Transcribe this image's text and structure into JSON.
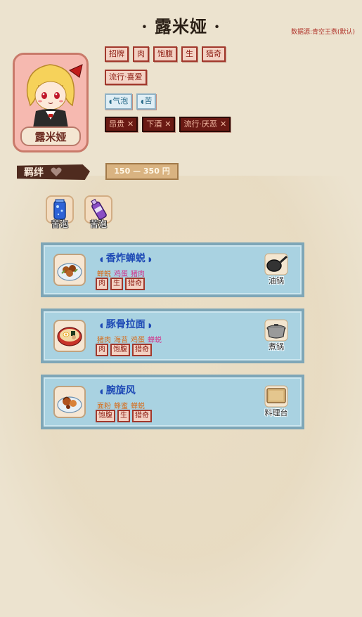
{
  "header": {
    "title": "· 露米娅 ·",
    "data_source": "数据源:青空王燕(默认)"
  },
  "character": {
    "name": "露米娅",
    "portrait_icon": "rumia-portrait-icon"
  },
  "positive_tags_row1": [
    "招牌",
    "肉",
    "饱腹",
    "生",
    "猎奇"
  ],
  "positive_tags_row2": [
    "流行·喜爱"
  ],
  "beverage_tags": [
    "气泡",
    "苦"
  ],
  "negative_tags": [
    {
      "label": "昂贵",
      "x": "✕"
    },
    {
      "label": "下酒",
      "x": "✕"
    },
    {
      "label": "流行·厌恶",
      "x": "✕"
    }
  ],
  "bond": {
    "label": "羁绊",
    "icon": "heart-icon"
  },
  "price": "150 — 350 円",
  "beverages": [
    {
      "label": "苦泡",
      "icon": "blue-drink-icon"
    },
    {
      "label": "苦泡",
      "icon": "purple-drink-icon"
    }
  ],
  "dishes": [
    {
      "name": "香炸蝉蜕",
      "ingredients": [
        {
          "name": "蝉蜕",
          "hi": false
        },
        {
          "name": "鸡蛋",
          "hi": true
        },
        {
          "name": "猪肉",
          "hi": true
        }
      ],
      "tags": [
        "肉",
        "生",
        "猎奇"
      ],
      "tool": "油锅",
      "icon": "fried-dish-icon",
      "tool_icon": "frying-pan-icon"
    },
    {
      "name": "豚骨拉面",
      "ingredients": [
        {
          "name": "猪肉",
          "hi": false
        },
        {
          "name": "海苔",
          "hi": false
        },
        {
          "name": "鸡蛋",
          "hi": false
        },
        {
          "name": "蝉蜕",
          "hi": true
        }
      ],
      "tags": [
        "肉",
        "饱腹",
        "猎奇"
      ],
      "tool": "煮锅",
      "icon": "ramen-icon",
      "tool_icon": "pot-icon"
    },
    {
      "name": "腕旋风",
      "ingredients": [
        {
          "name": "面粉",
          "hi": false
        },
        {
          "name": "蜂蜜",
          "hi": false
        },
        {
          "name": "蝉蜕",
          "hi": false
        }
      ],
      "tags": [
        "饱腹",
        "生",
        "猎奇"
      ],
      "tool": "料理台",
      "icon": "pastry-icon",
      "tool_icon": "cutting-board-icon"
    }
  ],
  "colors": {
    "background": "#ece3cf",
    "tag_red": "#a1382c",
    "dish_card": "#a9d2e1",
    "dish_name": "#1d49b5"
  }
}
